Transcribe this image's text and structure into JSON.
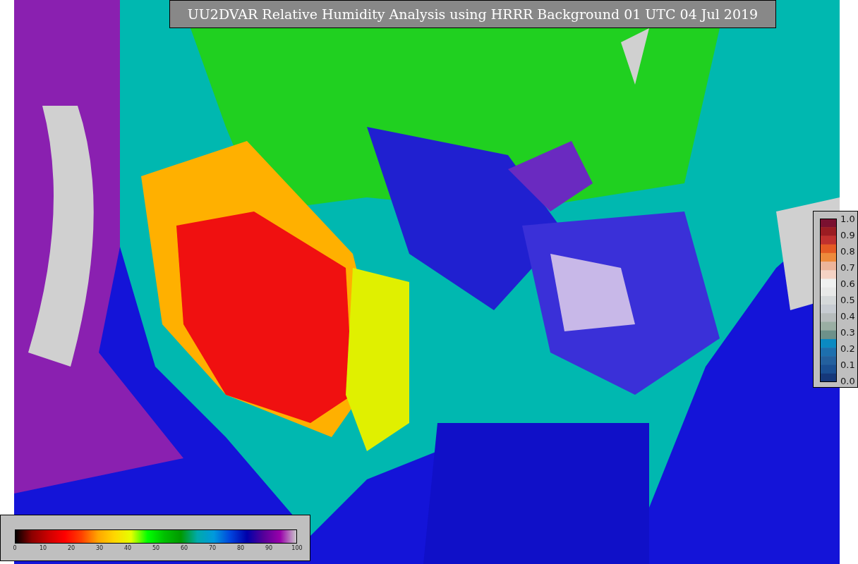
{
  "title": "UU2DVAR Relative Humidity Analysis using HRRR Background 01 UTC 04 Jul 2019",
  "humidity_colorbar": {
    "tick_labels": [
      "0",
      "10",
      "20",
      "30",
      "40",
      "50",
      "60",
      "70",
      "80",
      "90",
      "100"
    ]
  },
  "station_colorbar": {
    "tick_labels": [
      "1.0",
      "0.9",
      "0.8",
      "0.7",
      "0.6",
      "0.5",
      "0.4",
      "0.3",
      "0.2",
      "0.1",
      "0.0"
    ]
  }
}
